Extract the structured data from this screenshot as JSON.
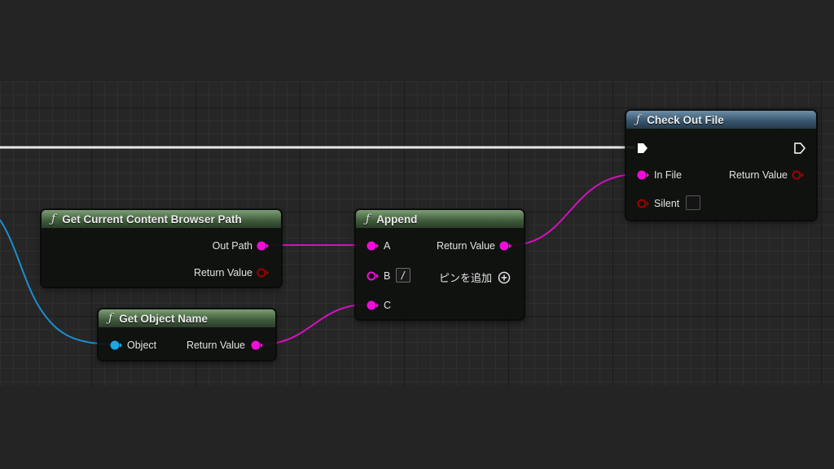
{
  "nodes": {
    "get_browser_path": {
      "title": "Get Current Content Browser Path",
      "out_path": "Out Path",
      "return_value": "Return Value"
    },
    "get_object_name": {
      "title": "Get Object Name",
      "object": "Object",
      "return_value": "Return Value"
    },
    "append": {
      "title": "Append",
      "a": "A",
      "b": "B",
      "b_value": "/",
      "c": "C",
      "return_value": "Return Value",
      "add_pin": "ピンを追加"
    },
    "check_out_file": {
      "title": "Check Out File",
      "in_file": "In File",
      "silent": "Silent",
      "return_value": "Return Value"
    }
  },
  "icons": {
    "function": "ƒ"
  },
  "colors": {
    "string_pin": "#f20cd9",
    "object_pin": "#1aa7e8",
    "bool_pin": "#8c0000",
    "exec_wire": "#ffffff",
    "header_pure": "#4a6b45",
    "header_impure": "#3d5d78"
  }
}
